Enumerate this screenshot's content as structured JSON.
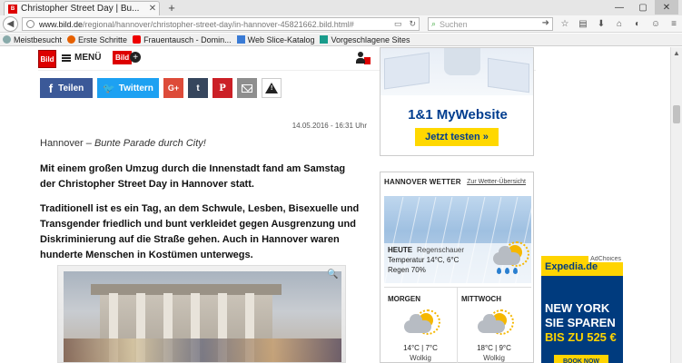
{
  "browser": {
    "tab_title": "Christopher Street Day | Bu...",
    "url_domain": "www.bild.de",
    "url_path": "/regional/hannover/christopher-street-day/in-hannover-45821662.bild.html#",
    "search_placeholder": "Suchen",
    "bookmarks": [
      {
        "label": "Meistbesucht",
        "icon": "gear-icon"
      },
      {
        "label": "Erste Schritte",
        "icon": "firefox-icon"
      },
      {
        "label": "Frauentausch - Domin...",
        "icon": "youtube-icon"
      },
      {
        "label": "Web Slice-Katalog",
        "icon": "webslice-icon"
      },
      {
        "label": "Vorgeschlagene Sites",
        "icon": "bing-icon"
      }
    ]
  },
  "header": {
    "logo": "Bild",
    "menu_label": "MENÜ",
    "plus_logo": "Bild"
  },
  "share": {
    "facebook": "Teilen",
    "twitter": "Twittern",
    "googleplus": "G+",
    "tumblr": "t",
    "pinterest": "P"
  },
  "article": {
    "date": "14.05.2016 - 16:31 Uhr",
    "location": "Hannover –",
    "kicker": "Bunte Parade durch City!",
    "lead": "Mit einem großen Umzug durch die Innenstadt fand am Samstag der Christopher Street Day in Hannover statt.",
    "paragraph": "Traditionell ist es ein Tag, an dem Schwule, Lesben, Bisexuelle und Transgender friedlich und bunt verkleidet gegen Ausgrenzung und Diskriminierung auf die Straße gehen. Auch in Hannover waren hunderte Menschen in Kostümen unterwegs."
  },
  "ad_top": {
    "brand": "1&1 MyWebsite",
    "cta": "Jetzt testen »"
  },
  "weather": {
    "title": "HANNOVER WETTER",
    "link": "Zur Wetter-Übersicht",
    "today_label": "HEUTE",
    "today_condition": "Regenschauer",
    "today_temp": "Temperatur  14°C, 6°C",
    "today_rain": "Regen  70%",
    "days": [
      {
        "name": "MORGEN",
        "temp": "14°C | 7°C",
        "condition": "Wolkig",
        "icon": "partly-cloudy-icon"
      },
      {
        "name": "MITTWOCH",
        "temp": "18°C | 9°C",
        "condition": "Wolkig",
        "icon": "partly-cloudy-icon"
      }
    ]
  },
  "ad_side": {
    "adchoices": "AdChoices",
    "brand": "Expedia.de",
    "line1": "NEW YORK",
    "line2": "SIE SPAREN",
    "line3": "BIS ZU 525 €",
    "cta": "BOOK NOW"
  }
}
